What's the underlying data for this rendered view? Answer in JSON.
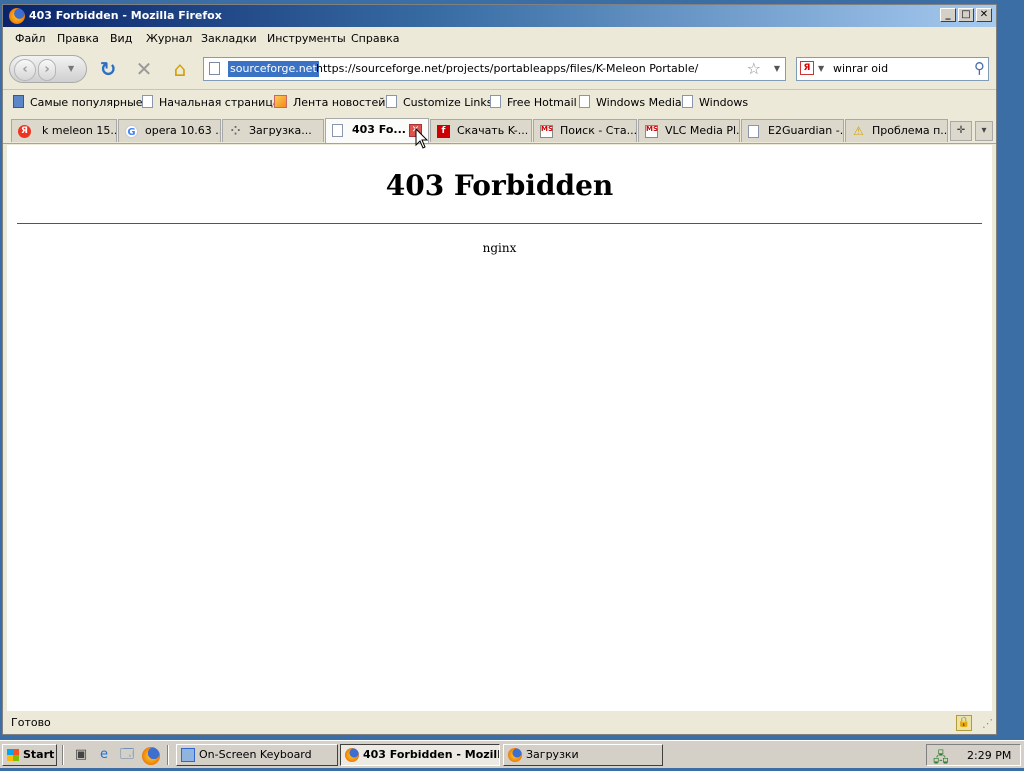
{
  "window": {
    "title": "403 Forbidden - Mozilla Firefox"
  },
  "menu": [
    "Файл",
    "Правка",
    "Вид",
    "Журнал",
    "Закладки",
    "Инструменты",
    "Справка"
  ],
  "navbar": {
    "identity": "sourceforge.net",
    "url": "https://sourceforge.net/projects/portableapps/files/K-Meleon Portable/",
    "search_value": "winrar oid",
    "search_engine": "Я"
  },
  "bookmarks": [
    "Самые популярные",
    "Начальная страница",
    "Лента новостей",
    "Customize Links",
    "Free Hotmail",
    "Windows Media",
    "Windows"
  ],
  "tabs": [
    {
      "label": "k meleon 15....",
      "icon": "Я"
    },
    {
      "label": "opera 10.63 ...",
      "icon": "G"
    },
    {
      "label": "Загрузка...",
      "icon": "⁘"
    },
    {
      "label": "403 Fo...",
      "icon": ""
    },
    {
      "label": "Скачать K-...",
      "icon": "f"
    },
    {
      "label": "Поиск - Ста...",
      "icon": "MS"
    },
    {
      "label": "VLC Media Pl...",
      "icon": "MS"
    },
    {
      "label": "E2Guardian -...",
      "icon": ""
    },
    {
      "label": "Проблема п...",
      "icon": "⚠"
    }
  ],
  "content": {
    "heading": "403 Forbidden",
    "server": "nginx"
  },
  "status": {
    "text": "Готово"
  },
  "taskbar": {
    "start": "Start",
    "buttons": [
      "On-Screen Keyboard",
      "403 Forbidden - Mozill...",
      "Загрузки"
    ],
    "clock": "2:29 PM"
  }
}
